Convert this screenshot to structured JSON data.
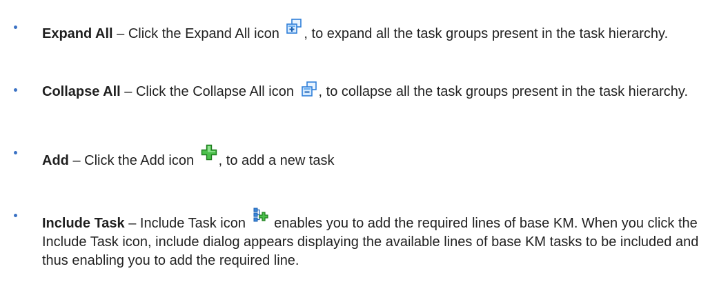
{
  "items": [
    {
      "term": "Expand All",
      "before_icon": " – Click the Expand All icon",
      "icon": "expand-all-icon",
      "after_icon": ", to expand all the task groups present in the task hierarchy."
    },
    {
      "term": "Collapse All",
      "before_icon": " – Click the Collapse All icon",
      "icon": "collapse-all-icon",
      "after_icon": ", to collapse all the task groups present in the task hierarchy."
    },
    {
      "term": "Add",
      "before_icon": " – Click the Add icon",
      "icon": "add-icon",
      "after_icon": ", to add a new task"
    },
    {
      "term": "Include Task",
      "before_icon": " – Include Task icon",
      "icon": "include-task-icon",
      "after_icon": "enables you to add the required lines of base KM. When you click the Include Task icon, include dialog appears displaying the available lines of base KM tasks to be included and thus enabling you to add the required line."
    }
  ],
  "colors": {
    "bullet": "#3b72c4",
    "icon_blue": "#2f7fd8",
    "icon_green": "#2fa82f"
  }
}
